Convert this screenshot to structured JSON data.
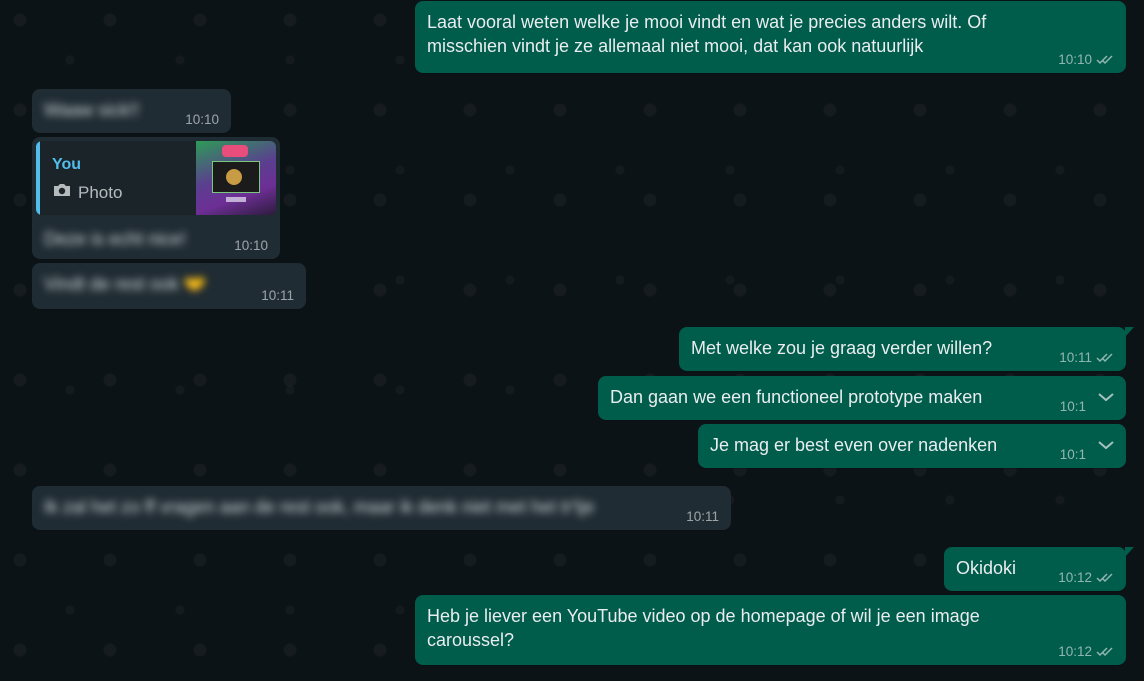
{
  "colors": {
    "outgoing": "#005c4b",
    "incoming": "#202c33",
    "read_ticks": "#53bdeb",
    "quote_accent": "#53bdeb"
  },
  "messages": [
    {
      "dir": "out",
      "text": "Laat vooral weten welke je mooi vindt en wat je precies anders wilt. Of\nmisschien vindt je ze allemaal niet mooi, dat kan ook natuurlijk",
      "time": "10:10",
      "status": "double-check-icon"
    },
    {
      "dir": "in",
      "text": "Waaw sick!!",
      "time": "10:10",
      "blurred": true
    },
    {
      "dir": "in",
      "quote": {
        "author": "You",
        "kind": "Photo",
        "icon": "camera-icon"
      },
      "text": "Deze is echt nice!",
      "time": "10:10",
      "blurred": true
    },
    {
      "dir": "in",
      "text": "Vindt de rest ook 🤝",
      "time": "10:11",
      "blurred": true
    },
    {
      "dir": "out",
      "text": "Met welke zou je graag verder willen?",
      "time": "10:11",
      "status": "double-check-icon"
    },
    {
      "dir": "out",
      "text": "Dan gaan we een functioneel prototype maken",
      "time": "10:1",
      "menu_icon": "chevron-down-icon"
    },
    {
      "dir": "out",
      "text": "Je mag er best even over nadenken",
      "time": "10:1",
      "menu_icon": "chevron-down-icon"
    },
    {
      "dir": "in",
      "text": "Ik zal het zo ff vragen aan de rest ook, maar ik denk niet met het tr'tje",
      "time": "10:11",
      "blurred": true
    },
    {
      "dir": "out",
      "text": "Okidoki",
      "time": "10:12",
      "status": "double-check-icon"
    },
    {
      "dir": "out",
      "text": "Heb je liever een YouTube video op de homepage of wil je een image\ncaroussel?",
      "time": "10:12",
      "status": "double-check-icon"
    }
  ]
}
